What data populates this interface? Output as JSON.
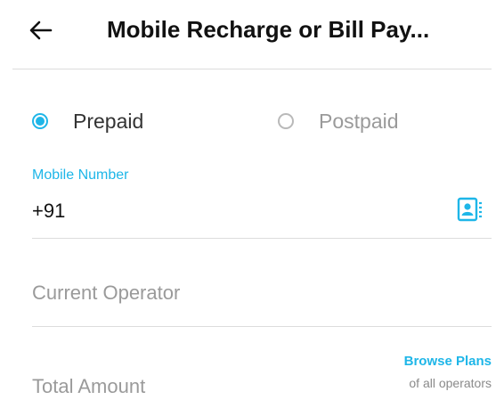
{
  "header": {
    "title": "Mobile Recharge or Bill Pay...",
    "back_icon": "arrow-left-icon"
  },
  "plan_type": {
    "selected": "prepaid",
    "options": [
      {
        "id": "prepaid",
        "label": "Prepaid"
      },
      {
        "id": "postpaid",
        "label": "Postpaid"
      }
    ]
  },
  "mobile": {
    "label": "Mobile Number",
    "value": "+91",
    "contact_icon": "contact-book-icon"
  },
  "operator": {
    "placeholder": "Current Operator"
  },
  "amount": {
    "placeholder": "Total Amount"
  },
  "browse_plans": {
    "title": "Browse Plans",
    "subtitle": "of all operators"
  },
  "colors": {
    "accent": "#1eb6e8",
    "text": "#111111",
    "muted": "#9a9a9a",
    "divider": "#dcdcdc"
  }
}
